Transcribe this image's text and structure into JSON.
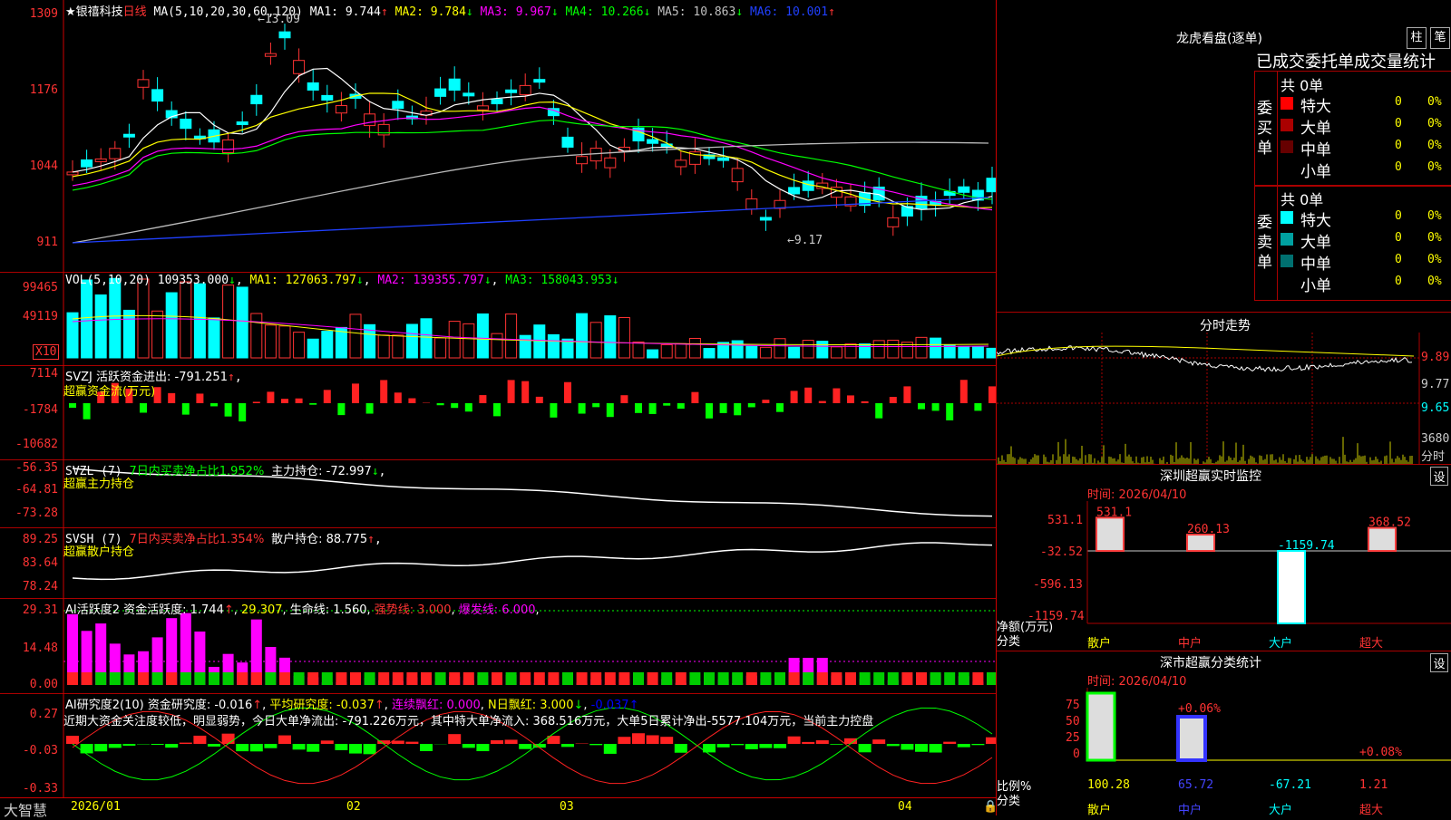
{
  "stock": {
    "name": "★银禧科技",
    "period": "日线",
    "ma_params": "MA(5,10,20,30,60,120)",
    "ma": [
      {
        "label": "MA1: 9.744",
        "arrow": "↑",
        "color": "#ffffff"
      },
      {
        "label": "MA2: 9.784",
        "arrow": "↓",
        "color": "#ffff00"
      },
      {
        "label": "MA3: 9.967",
        "arrow": "↓",
        "color": "#ff00ff"
      },
      {
        "label": "MA4: 10.266",
        "arrow": "↓",
        "color": "#00ff00"
      },
      {
        "label": "MA5: 10.863",
        "arrow": "↓",
        "color": "#c0c0c0"
      },
      {
        "label": "MA6: 10.001",
        "arrow": "↑",
        "color": "#2040ff"
      }
    ],
    "y_labels": [
      "1309",
      "1176",
      "1044",
      "911"
    ],
    "high_mark": "13.09",
    "low_mark": "9.17"
  },
  "vol": {
    "header": "VOL(5,10,20)",
    "value": "109353.000",
    "ma1": "MA1: 127063.797",
    "ma2": "MA2: 139355.797",
    "ma3": "MA3: 158043.953",
    "y_labels": [
      "99465",
      "49119"
    ],
    "unit": "X10"
  },
  "svzj": {
    "header": "SVZJ  活跃资金进出: -791.251",
    "arrow": "↑",
    "subtitle": "超赢资金流(万元)",
    "y_labels": [
      "7114",
      "-1784",
      "-10682"
    ]
  },
  "svzl": {
    "header": "SVZL (7)",
    "text1": "7日内买卖净占比1.952%",
    "text2": "主力持仓: -72.997",
    "arrow": "↓",
    "subtitle": "超赢主力持仓",
    "y_labels": [
      "-56.35",
      "-64.81",
      "-73.28"
    ]
  },
  "svsh": {
    "header": "SVSH (7)",
    "text1": "7日内买卖净占比1.354%",
    "text2": "散户持仓: 88.775",
    "arrow": "↑",
    "subtitle": "超赢散户持仓",
    "y_labels": [
      "89.25",
      "83.64",
      "78.24"
    ]
  },
  "ai_act": {
    "header": "AI活跃度2 资金活跃度: 1.744",
    "v2": "29.307",
    "v3": "生命线: 1.560",
    "v4": "强势线: 3.000",
    "v5": "爆发线: 6.000",
    "y_labels": [
      "29.31",
      "14.48",
      "0.00"
    ]
  },
  "ai_res": {
    "header": "AI研究度2(10) 资金研究度: -0.016",
    "v2": "平均研究度: -0.037",
    "v3": "连续飘红: 0.000",
    "v4": "N日飘红: 3.000",
    "v5": "-0.037",
    "comment": "近期大资金关注度较低，明显弱势，今日大单净流出: -791.226万元，其中特大单净流入: 368.516万元，大单5日累计净出-5577.104万元，当前主力控盘",
    "y_labels": [
      "0.27",
      "-0.03",
      "-0.33"
    ]
  },
  "bottom": {
    "brand": "大智慧",
    "months": [
      "2026/01",
      "02",
      "03",
      "04"
    ]
  },
  "right": {
    "title": "龙虎看盘(逐单)",
    "btn1": "柱",
    "btn2": "笔",
    "stats_title": "已成交委托单成交量统计",
    "buy_label": "委买单",
    "sell_label": "委卖单",
    "buy_total": "共 0单",
    "sell_total": "共 0单",
    "buy_rows": [
      {
        "name": "特大",
        "count": "0",
        "pct": "0%",
        "color": "#ff0000"
      },
      {
        "name": "大单",
        "count": "0",
        "pct": "0%",
        "color": "#aa0000"
      },
      {
        "name": "中单",
        "count": "0",
        "pct": "0%",
        "color": "#660000"
      },
      {
        "name": "小单",
        "count": "0",
        "pct": "0%",
        "color": "#000000"
      }
    ],
    "sell_rows": [
      {
        "name": "特大",
        "count": "0",
        "pct": "0%",
        "color": "#00ffff"
      },
      {
        "name": "大单",
        "count": "0",
        "pct": "0%",
        "color": "#00a0a0"
      },
      {
        "name": "中单",
        "count": "0",
        "pct": "0%",
        "color": "#007070"
      },
      {
        "name": "小单",
        "count": "0",
        "pct": "0%",
        "color": "#000000"
      }
    ],
    "fenshi_title": "分时走势",
    "fenshi_y": [
      "9.89",
      "9.77",
      "9.65"
    ],
    "fenshi_vol": "3680",
    "fenshi_vol_unit": "分时",
    "sz_title": "深圳超赢实时监控",
    "sz_set": "设",
    "sz_time": "时间: 2026/04/10",
    "sz_y": [
      "531.1",
      "-32.52",
      "-596.13",
      "-1159.74"
    ],
    "sz_bars": [
      {
        "label": "531.1",
        "value": 531.1,
        "color": "#ff4040"
      },
      {
        "label": "260.13",
        "value": 260.13,
        "color": "#ff4040"
      },
      {
        "label": "-1159.74",
        "value": -1159.74,
        "color": "#00ffff"
      },
      {
        "label": "368.52",
        "value": 368.52,
        "color": "#ff4040"
      }
    ],
    "sz_axis1": "净额(万元)",
    "sz_axis2": "分类",
    "cats": [
      "散户",
      "中户",
      "大户",
      "超大"
    ],
    "sm_title": "深市超赢分类统计",
    "sm_set": "设",
    "sm_time": "时间: 2026/04/10",
    "sm_y": [
      "75",
      "50",
      "25",
      "0"
    ],
    "sm_pct": [
      "+0.06%",
      "+0.08%"
    ],
    "sm_vals": [
      "100.28",
      "65.72",
      "-67.21",
      "1.21"
    ],
    "sm_axis1": "比例%",
    "sm_axis2": "分类"
  }
}
